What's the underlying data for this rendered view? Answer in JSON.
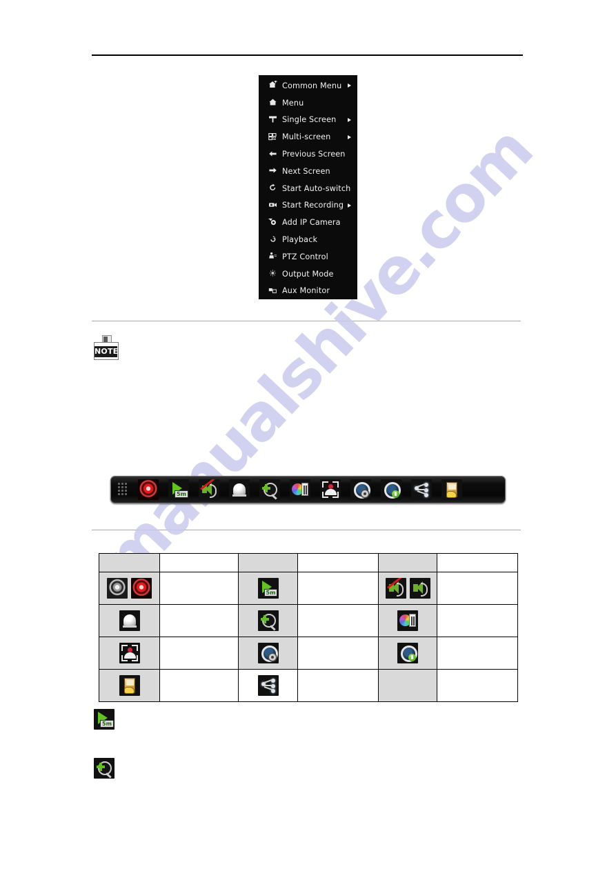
{
  "page": {
    "background_color": "#ffffff",
    "watermark_text": "manualshive.com",
    "watermark_color": "#c9cbee"
  },
  "context_menu": {
    "name": "right-click-context-menu",
    "background_color": "#0b0b0b",
    "text_color": "#f2f2f2",
    "items": [
      {
        "label": "Common Menu",
        "icon": "home-plus-icon",
        "has_submenu": true
      },
      {
        "label": "Menu",
        "icon": "home-icon",
        "has_submenu": false
      },
      {
        "label": "Single Screen",
        "icon": "single-screen-icon",
        "has_submenu": true
      },
      {
        "label": "Multi-screen",
        "icon": "multi-screen-icon",
        "has_submenu": true
      },
      {
        "label": "Previous Screen",
        "icon": "arrow-left-icon",
        "has_submenu": false
      },
      {
        "label": "Next Screen",
        "icon": "arrow-right-icon",
        "has_submenu": false
      },
      {
        "label": "Start Auto-switch",
        "icon": "refresh-icon",
        "has_submenu": false
      },
      {
        "label": "Start Recording",
        "icon": "record-camera-icon",
        "has_submenu": true
      },
      {
        "label": "Add IP Camera",
        "icon": "ip-camera-add-icon",
        "has_submenu": false
      },
      {
        "label": "Playback",
        "icon": "playback-icon",
        "has_submenu": false
      },
      {
        "label": "PTZ Control",
        "icon": "ptz-icon",
        "has_submenu": false
      },
      {
        "label": "Output Mode",
        "icon": "output-mode-icon",
        "has_submenu": false
      },
      {
        "label": "Aux Monitor",
        "icon": "aux-monitor-icon",
        "has_submenu": false
      }
    ]
  },
  "note_badge": {
    "name": "note-badge",
    "label": "NOTE"
  },
  "quick_toolbar": {
    "name": "quick-setting-toolbar",
    "buttons": [
      {
        "name": "grip-handle",
        "icon": "drag-grip-icon"
      },
      {
        "name": "start-record-button",
        "icon": "record-on-icon"
      },
      {
        "name": "instant-playback-button",
        "icon": "playback-5m-icon"
      },
      {
        "name": "audio-mute-button",
        "icon": "audio-off-icon"
      },
      {
        "name": "alarm-output-button",
        "icon": "alarm-dome-icon"
      },
      {
        "name": "digital-zoom-button",
        "icon": "zoom-in-icon"
      },
      {
        "name": "image-settings-button",
        "icon": "color-settings-icon"
      },
      {
        "name": "live-view-strategy-button",
        "icon": "live-view-target-icon"
      },
      {
        "name": "face-detection-button",
        "icon": "face-settings-icon"
      },
      {
        "name": "face-capture-button",
        "icon": "face-capture-icon"
      },
      {
        "name": "information-button",
        "icon": "network-share-icon"
      },
      {
        "name": "close-toolbar-button",
        "icon": "exit-door-icon"
      }
    ]
  },
  "icon_table": {
    "name": "toolbar-icon-reference-table",
    "columns": 6,
    "header_row": [
      "",
      "",
      "",
      "",
      "",
      ""
    ],
    "rows": [
      {
        "cells": [
          {
            "type": "icons",
            "icons": [
              "record-off-icon",
              "record-on-icon"
            ],
            "shaded": true
          },
          {
            "type": "text",
            "text": "",
            "shaded": false
          },
          {
            "type": "icons",
            "icons": [
              "playback-5m-icon"
            ],
            "shaded": true
          },
          {
            "type": "text",
            "text": "",
            "shaded": false
          },
          {
            "type": "icons",
            "icons": [
              "audio-off-icon",
              "audio-on-icon"
            ],
            "shaded": true
          },
          {
            "type": "text",
            "text": "",
            "shaded": false
          }
        ]
      },
      {
        "cells": [
          {
            "type": "icons",
            "icons": [
              "alarm-dome-icon"
            ],
            "shaded": true
          },
          {
            "type": "text",
            "text": "",
            "shaded": false
          },
          {
            "type": "icons",
            "icons": [
              "zoom-in-icon"
            ],
            "shaded": true
          },
          {
            "type": "text",
            "text": "",
            "shaded": false
          },
          {
            "type": "icons",
            "icons": [
              "color-settings-icon"
            ],
            "shaded": true
          },
          {
            "type": "text",
            "text": "",
            "shaded": false
          }
        ]
      },
      {
        "cells": [
          {
            "type": "icons",
            "icons": [
              "live-view-target-icon"
            ],
            "shaded": true
          },
          {
            "type": "text",
            "text": "",
            "shaded": false
          },
          {
            "type": "icons",
            "icons": [
              "face-settings-icon"
            ],
            "shaded": true
          },
          {
            "type": "text",
            "text": "",
            "shaded": false
          },
          {
            "type": "icons",
            "icons": [
              "face-capture-icon"
            ],
            "shaded": true
          },
          {
            "type": "text",
            "text": "",
            "shaded": false
          }
        ]
      },
      {
        "cells": [
          {
            "type": "icons",
            "icons": [
              "exit-door-icon"
            ],
            "shaded": true
          },
          {
            "type": "text",
            "text": "",
            "shaded": false
          },
          {
            "type": "icons",
            "icons": [
              "network-share-icon"
            ],
            "shaded": false
          },
          {
            "type": "text",
            "text": "",
            "shaded": false
          },
          {
            "type": "text",
            "text": "",
            "shaded": true
          },
          {
            "type": "text",
            "text": "",
            "shaded": false
          }
        ]
      }
    ]
  },
  "footnotes": [
    {
      "name": "footnote-instant-playback",
      "icon": "playback-5m-icon",
      "text": ""
    },
    {
      "name": "footnote-digital-zoom",
      "icon": "zoom-in-icon",
      "text": ""
    }
  ]
}
